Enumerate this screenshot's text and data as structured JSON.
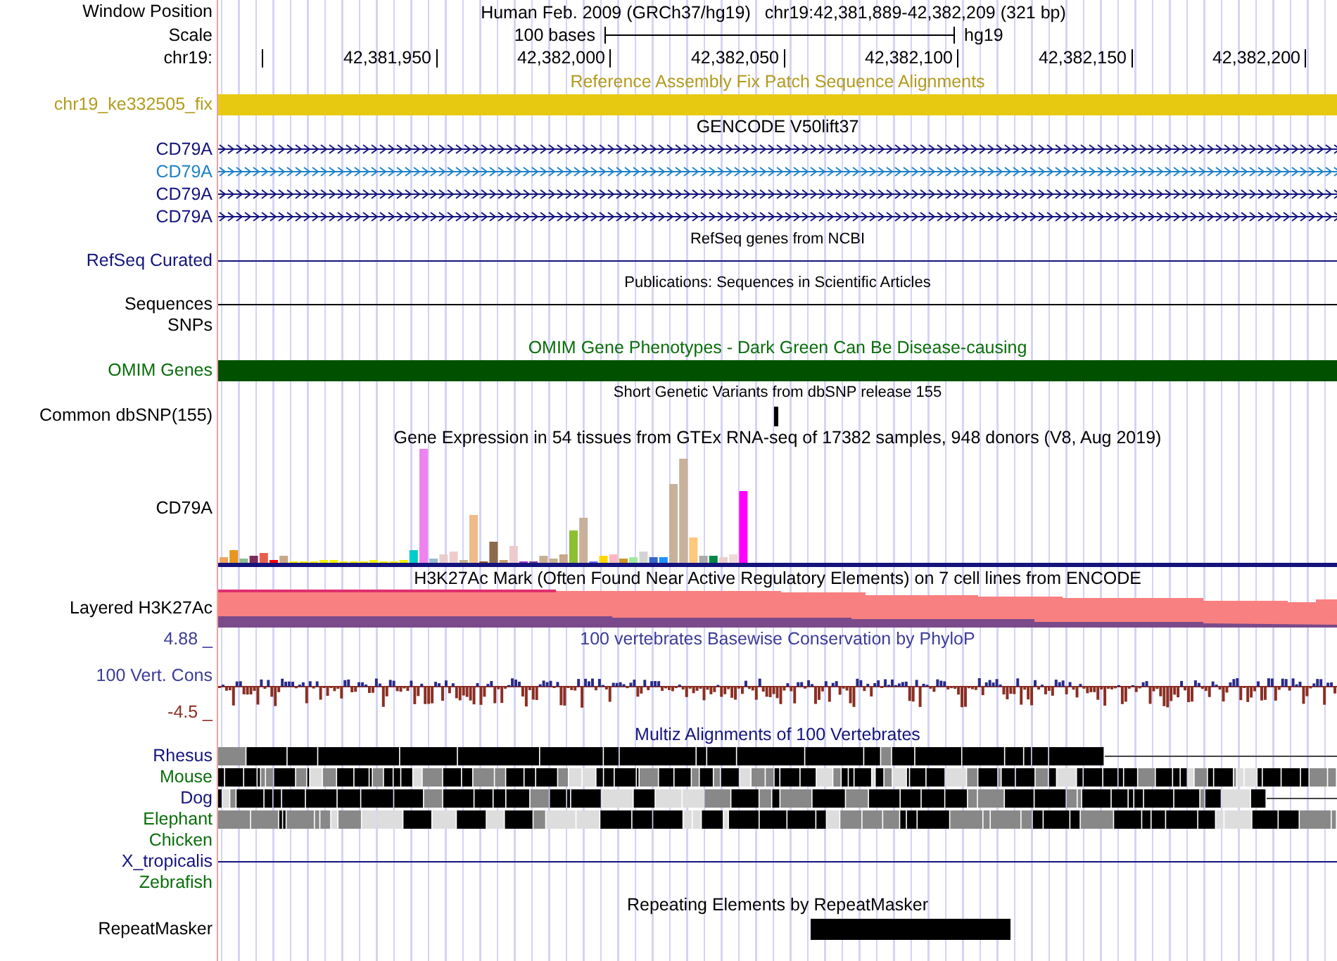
{
  "header": {
    "position_label": "Window Position",
    "assembly": "Human Feb. 2009 (GRCh37/hg19)",
    "position": "chr19:42,381,889-42,382,209 (321 bp)",
    "scale_label": "Scale",
    "scale_text": "100 bases",
    "scale_db": "hg19",
    "chrom_label": "chr19:",
    "ticks": [
      "42,381,950",
      "42,382,000",
      "42,382,050",
      "42,382,100",
      "42,382,150",
      "42,382,200"
    ]
  },
  "tracks": [
    {
      "title": "Reference Assembly Fix Patch Sequence Alignments",
      "color": "#b39b1d",
      "rows": [
        {
          "kind": "bar",
          "label": "chr19_ke332505_fix",
          "color": "#b39b1d",
          "bar": {
            "color": "#e8c912"
          }
        }
      ]
    },
    {
      "title": "GENCODE V50lift37",
      "color": "#000000",
      "rows": [
        {
          "kind": "gene",
          "label": "CD79A",
          "color": "#14147c"
        },
        {
          "kind": "gene",
          "label": "CD79A",
          "color": "#1e82c8"
        },
        {
          "kind": "gene",
          "label": "CD79A",
          "color": "#14147c"
        },
        {
          "kind": "gene",
          "label": "CD79A",
          "color": "#14147c"
        }
      ]
    },
    {
      "title": "RefSeq genes from NCBI",
      "color": "#000000",
      "rows": [
        {
          "kind": "line",
          "label": "RefSeq Curated",
          "color": "#14147c"
        }
      ]
    },
    {
      "title": "Publications: Sequences in Scientific Articles",
      "color": "#000000",
      "rows": [
        {
          "kind": "line",
          "label": "Sequences",
          "color": "#000000"
        },
        {
          "kind": "none",
          "label": "SNPs",
          "color": "#000000"
        }
      ]
    },
    {
      "title": "OMIM Gene Phenotypes - Dark Green Can Be Disease-causing",
      "color": "#0a6e0a",
      "rows": [
        {
          "kind": "bar",
          "label": "OMIM Genes",
          "color": "#0a6e0a",
          "bar": {
            "color": "#005000"
          }
        }
      ]
    },
    {
      "title": "Short Genetic Variants from dbSNP release 155",
      "color": "#000000",
      "rows": [
        {
          "kind": "snp",
          "label": "Common dbSNP(155)",
          "color": "#000000"
        }
      ]
    },
    {
      "title": "Gene Expression in 54 tissues from GTEx RNA-seq of 17382 samples, 948 donors (V8, Aug 2019)",
      "color": "#000000",
      "rows": [
        {
          "kind": "gtex",
          "label": "CD79A",
          "color": "#000000"
        }
      ]
    },
    {
      "title": "H3K27Ac Mark (Often Found Near Active Regulatory Elements) on 7 cell lines from ENCODE",
      "color": "#000000",
      "rows": [
        {
          "kind": "layered",
          "label": "Layered H3K27Ac",
          "color": "#000000"
        }
      ]
    },
    {
      "title": "100 vertebrates Basewise Conservation by PhyloP",
      "color": "#3c3c96",
      "rows": [
        {
          "kind": "wiggle",
          "label": "100 Vert. Cons",
          "color": "#3c3c96",
          "max_label": "4.88 _",
          "min": {
            "label": "-4.5 _",
            "color": "#8b2e22"
          }
        }
      ]
    },
    {
      "title": "Multiz Alignments of 100 Vertebrates",
      "color": "#14147c",
      "rows": [
        {
          "kind": "multiz",
          "label": "Rhesus",
          "color": "#14147c"
        },
        {
          "kind": "multiz",
          "label": "Mouse",
          "color": "#0a6e0a"
        },
        {
          "kind": "multiz",
          "label": "Dog",
          "color": "#14147c"
        },
        {
          "kind": "multiz",
          "label": "Elephant",
          "color": "#0a6e0a"
        },
        {
          "kind": "none",
          "label": "Chicken",
          "color": "#0a6e0a"
        },
        {
          "kind": "line",
          "label": "X_tropicalis",
          "color": "#14147c"
        },
        {
          "kind": "none",
          "label": "Zebrafish",
          "color": "#0a6e0a"
        }
      ]
    },
    {
      "title": "Repeating Elements by RepeatMasker",
      "color": "#000000",
      "rows": [
        {
          "kind": "repeat",
          "label": "RepeatMasker",
          "color": "#000000"
        }
      ]
    }
  ]
}
